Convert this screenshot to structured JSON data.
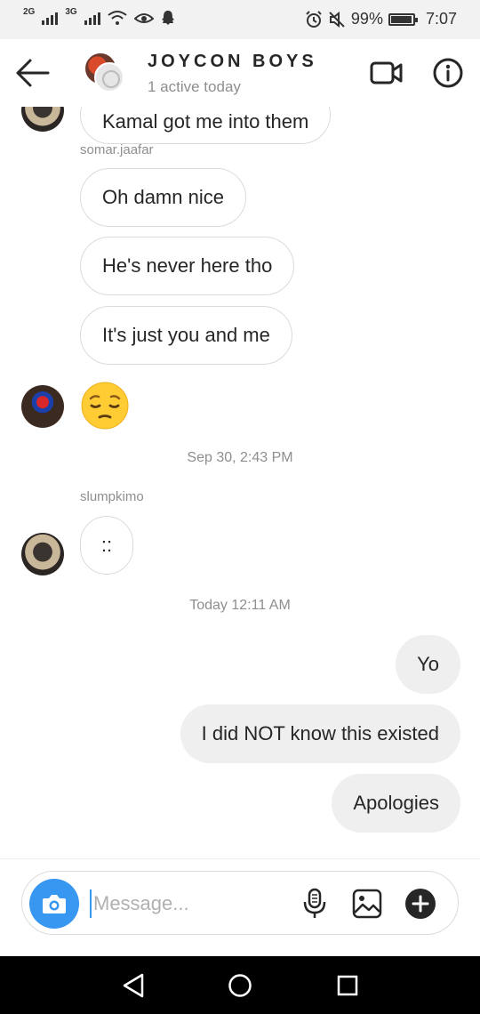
{
  "status_bar": {
    "signal1": "2G",
    "signal2": "3G",
    "battery": "99%",
    "time": "7:07"
  },
  "header": {
    "title": "JOYCON BOYS",
    "subtitle": "1 active today",
    "icons": [
      "back-arrow-icon",
      "group-avatar",
      "video-call-icon",
      "info-icon"
    ]
  },
  "messages": {
    "clipped_text": "Kamal got me into them",
    "sender_1": "somar.jaafar",
    "m1": "Oh damn nice",
    "m2": "He's never here tho",
    "m3": "It's just you and me",
    "emoji": "pensive-face-emoji",
    "timestamp_1": "Sep 30, 2:43 PM",
    "sender_2": "slumpkimo",
    "m4": "::",
    "timestamp_2": "Today 12:11 AM",
    "out1": "Yo",
    "out2": "I did NOT know this existed",
    "out3": "Apologies"
  },
  "composer": {
    "placeholder": "Message...",
    "icons": [
      "camera-icon",
      "microphone-icon",
      "gallery-icon",
      "plus-icon"
    ],
    "accent": "#3897f0"
  },
  "nav_bar": {
    "icons": [
      "nav-back-icon",
      "nav-home-icon",
      "nav-recents-icon"
    ]
  }
}
